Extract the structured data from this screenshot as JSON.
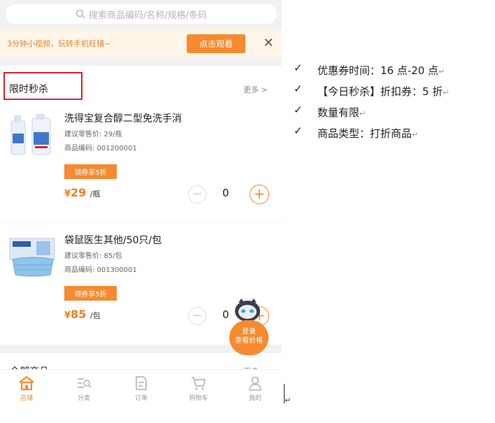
{
  "search": {
    "placeholder": "搜索商品编码/名称/规格/条码"
  },
  "promo": {
    "text": "3分钟小视频，玩转手机旺铺~",
    "button": "点击观看",
    "close": "✕"
  },
  "flash_sale": {
    "title": "限时秒杀",
    "more": "更多 >",
    "products": [
      {
        "name": "洗得宝复合醇二型免洗手消",
        "suggested_price": "建议零售价: 29/瓶",
        "code": "商品编码: 001200001",
        "coupon": "领券享5折",
        "currency": "¥",
        "price": "29",
        "unit": "/瓶",
        "qty": "0"
      },
      {
        "name": "袋鼠医生其他/50只/包",
        "suggested_price": "建议零售价: 85/包",
        "code": "商品编码: 001300001",
        "coupon": "领券享5折",
        "currency": "¥",
        "price": "85",
        "unit": "/包",
        "qty": "0"
      }
    ]
  },
  "all_products": {
    "title": "全部商品",
    "more": "更多 >"
  },
  "login_bubble": {
    "line1": "登录",
    "line2": "查看价格"
  },
  "tabbar": [
    {
      "label": "店铺",
      "icon": "home-icon",
      "active": true
    },
    {
      "label": "分类",
      "icon": "category-icon",
      "active": false
    },
    {
      "label": "订单",
      "icon": "order-icon",
      "active": false
    },
    {
      "label": "购物车",
      "icon": "cart-icon",
      "active": false
    },
    {
      "label": "我的",
      "icon": "user-icon",
      "active": false
    }
  ],
  "notes": [
    {
      "check": "✓",
      "text": "优惠券时间：16 点-20 点",
      "mark": "↵"
    },
    {
      "check": "✓",
      "text": "【今日秒杀】折扣券：5 折",
      "mark": "↵"
    },
    {
      "check": "✓",
      "text": "数量有限",
      "mark": "↵"
    },
    {
      "check": "✓",
      "text": "商品类型：打折商品",
      "mark": "↵"
    }
  ],
  "colors": {
    "accent": "#f68a2f",
    "highlight_border": "#e0202a"
  }
}
